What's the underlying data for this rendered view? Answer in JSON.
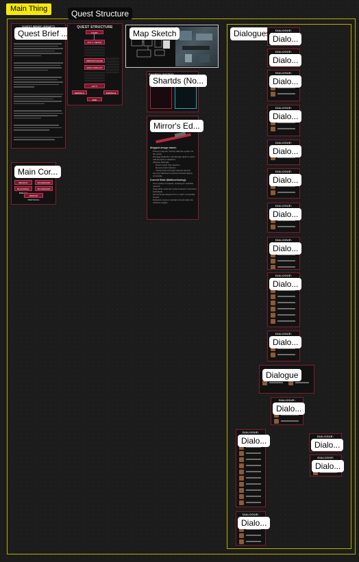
{
  "labels": {
    "main_thing": "Main Thing",
    "quest_structure_tag": "Quest Structure",
    "dialogues_tag": "Dialogues"
  },
  "boards": {
    "quest_brief": "Quest Brief ...",
    "quest_brief_header": "QUEST BRIEF (DRAFT)",
    "quest_structure_header": "QUEST STRUCTURE",
    "map_sketch": "Map Sketch",
    "shards": "Shartds (No...",
    "shards_header": "SHARDS (NOTES)",
    "mirrors_edge": "Mirror's Ed...",
    "main_cor": "Main Cor...",
    "dialogue_wide": "Dialogue"
  },
  "dialogue_short": "Dialo...",
  "dialogue_header": "DIALOGUE:",
  "mirror": {
    "heading1": "Shipped design intent:",
    "bullets1": [
      "Primary purpose: Perfect defense system for the owner",
      "Damage Reflection: All damage dealt to owner reflects back to attackers",
      "Infection Methods:",
      "Direct neural chip insertion",
      "Remote hack infection",
      "Transmission through infected devices",
      "Are any reflections toward protected targets vulnerable"
    ],
    "heading2": "Current State (Malfunctioning):",
    "bullets2": [
      "Core system corrupted, creating an unstable network",
      "Ownership randomly cycles between connected individuals",
      "All connected targets form a \"web\" of potential owners",
      "Reflection system maintains functionality but switches targets"
    ]
  },
  "main_cor_buttons": [
    "RECRUIT",
    "SILVERHAND ALTER",
    "BLACKWALL BREACH",
    "SILVERHAND",
    "MIRROR PROTOCOL"
  ],
  "quest_structure_nodes": [
    "START",
    "ACT 1 / SETUP",
    "MIRROR'S EDGE",
    "MAIN CONFLICT",
    "ACT 3",
    "ENDING A",
    "ENDING B",
    "END"
  ],
  "colors": {
    "accent": "#b7b100",
    "label_bg": "#f7e80b",
    "frame_border": "#7d1f2e",
    "button": "#7b1730"
  }
}
